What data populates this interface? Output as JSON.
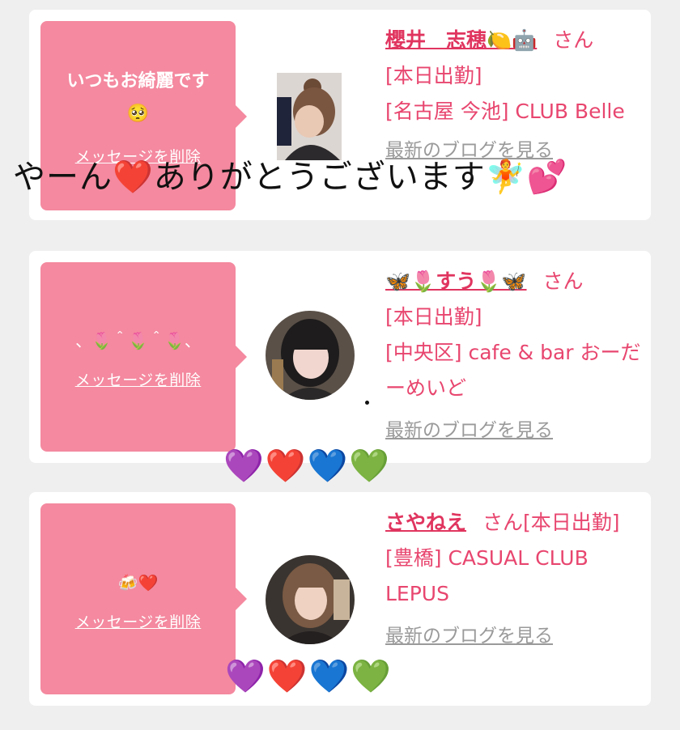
{
  "cards": [
    {
      "message": "いつもお綺麗です\n🥺",
      "delete_label": "メッセージを削除",
      "name": "櫻井　志穂🍋🤖",
      "san": "さん",
      "lines": [
        "[本日出勤]",
        "[名古屋 今池] CLUB Belle"
      ],
      "blog_label": "最新のブログを見る"
    },
    {
      "message": "、🌷＾🌷＾🌷、",
      "delete_label": "メッセージを削除",
      "name": "🦋🌷すう🌷🦋",
      "san": "さん",
      "lines": [
        "[本日出勤]",
        "[中央区] cafe & bar おーだーめいど"
      ],
      "blog_label": "最新のブログを見る"
    },
    {
      "message": "🍻❤️",
      "delete_label": "メッセージを削除",
      "name": "さやねえ",
      "san": "さん[本日出勤]",
      "lines": [
        "[豊橋] CASUAL CLUB LEPUS"
      ],
      "blog_label": "最新のブログを見る"
    }
  ],
  "overlay_caption": "やーん❤️ありがとうございます🧚💕",
  "hearts": "💜❤️💙💚",
  "colors": {
    "bubble": "#f4899f",
    "name": "#e0355f",
    "info_text": "#e8466f",
    "blog_link": "#9a9a9a"
  }
}
